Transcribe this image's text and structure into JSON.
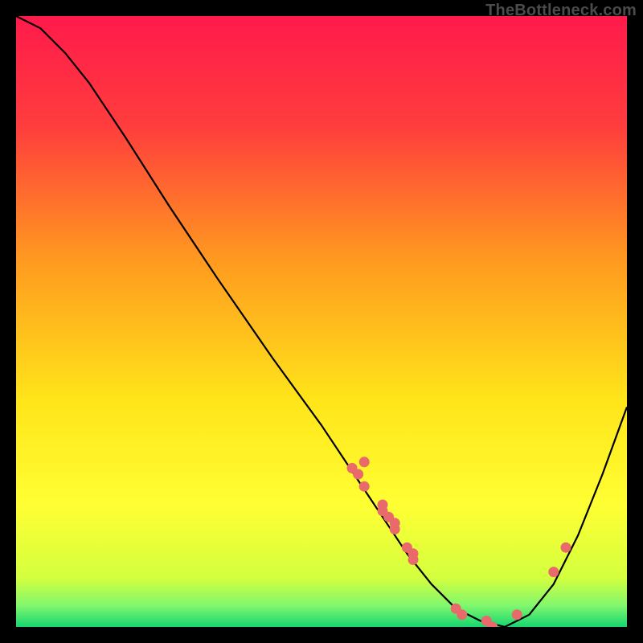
{
  "watermark": "TheBottleneck.com",
  "chart_data": {
    "type": "line",
    "title": "",
    "xlabel": "",
    "ylabel": "",
    "xlim": [
      0,
      100
    ],
    "ylim": [
      0,
      100
    ],
    "grid": false,
    "legend": false,
    "gradient_stops": [
      {
        "offset": 0,
        "color": "#ff1a4b"
      },
      {
        "offset": 0.18,
        "color": "#ff3d3d"
      },
      {
        "offset": 0.4,
        "color": "#ff9a1f"
      },
      {
        "offset": 0.63,
        "color": "#ffe51a"
      },
      {
        "offset": 0.8,
        "color": "#ffff33"
      },
      {
        "offset": 0.92,
        "color": "#d3ff3e"
      },
      {
        "offset": 0.965,
        "color": "#81f76e"
      },
      {
        "offset": 1.0,
        "color": "#16d66f"
      }
    ],
    "series": [
      {
        "name": "bottleneck-curve",
        "x": [
          0,
          4,
          8,
          12,
          18,
          25,
          33,
          42,
          50,
          56,
          60,
          64,
          68,
          72,
          76,
          80,
          84,
          88,
          92,
          96,
          100
        ],
        "y": [
          100,
          98,
          94,
          89,
          80,
          69,
          57,
          44,
          33,
          24,
          18,
          12,
          7,
          3,
          1,
          0,
          2,
          7,
          15,
          25,
          36
        ]
      }
    ],
    "scatter_points": {
      "name": "sample-points",
      "color": "#e96a6a",
      "x": [
        55,
        56,
        57,
        57,
        60,
        60,
        61,
        62,
        62,
        64,
        65,
        65,
        72,
        73,
        77,
        78,
        82,
        88,
        90
      ],
      "y": [
        26,
        25,
        23,
        27,
        19,
        20,
        18,
        16,
        17,
        13,
        12,
        11,
        3,
        2,
        1,
        0,
        2,
        9,
        13
      ]
    }
  }
}
